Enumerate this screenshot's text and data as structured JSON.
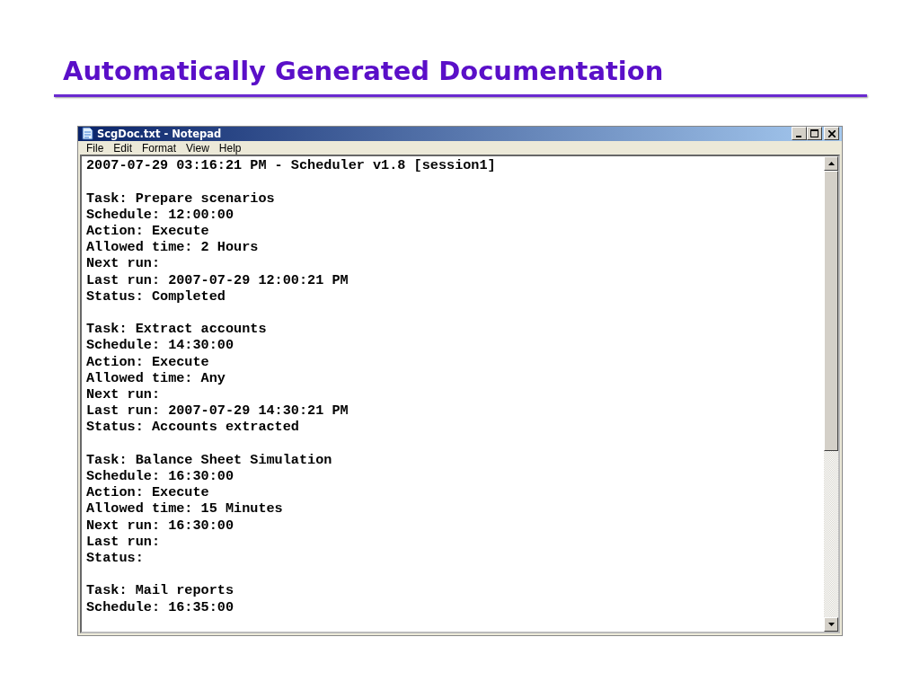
{
  "slide_title": "Automatically Generated Documentation",
  "window": {
    "title": "ScgDoc.txt - Notepad"
  },
  "menu": [
    "File",
    "Edit",
    "Format",
    "View",
    "Help"
  ],
  "document": [
    [
      "2007-07-29 03:16:21 PM - Scheduler v1.8 [session1]"
    ],
    [
      "Task: Prepare scenarios",
      "Schedule: 12:00:00",
      "Action: Execute",
      "Allowed time: 2 Hours",
      "Next run:",
      "Last run: 2007-07-29 12:00:21 PM",
      "Status: Completed"
    ],
    [
      "Task: Extract accounts",
      "Schedule: 14:30:00",
      "Action: Execute",
      "Allowed time: Any",
      "Next run:",
      "Last run: 2007-07-29 14:30:21 PM",
      "Status: Accounts extracted"
    ],
    [
      "Task: Balance Sheet Simulation",
      "Schedule: 16:30:00",
      "Action: Execute",
      "Allowed time: 15 Minutes",
      "Next run: 16:30:00",
      "Last run:",
      "Status:"
    ],
    [
      "Task: Mail reports",
      "Schedule: 16:35:00"
    ]
  ]
}
